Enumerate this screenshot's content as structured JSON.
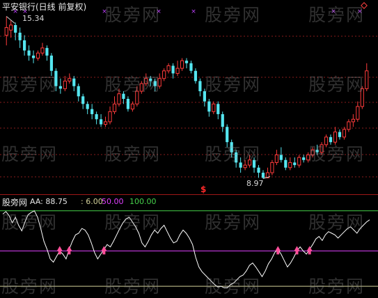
{
  "chart_data": [
    {
      "type": "candlestick",
      "title": "平安银行(日线 前复权)",
      "annotations": {
        "high_label": "15.34",
        "low_label": "8.97",
        "signal_glyph": "$"
      },
      "series": [
        {
          "name": "K线",
          "candles": [
            [
              14.6,
              14.9,
              15.34,
              14.2
            ],
            [
              14.8,
              15.0,
              15.2,
              14.5
            ],
            [
              15.0,
              14.7,
              15.1,
              14.4
            ],
            [
              14.7,
              14.4,
              14.9,
              14.1
            ],
            [
              14.4,
              14.0,
              14.6,
              13.8
            ],
            [
              14.0,
              13.8,
              14.2,
              13.6
            ],
            [
              13.8,
              13.7,
              14.0,
              13.5
            ],
            [
              13.7,
              13.9,
              14.0,
              13.6
            ],
            [
              13.9,
              14.1,
              14.3,
              13.8
            ],
            [
              14.1,
              13.8,
              14.2,
              13.6
            ],
            [
              13.8,
              13.2,
              13.9,
              13.0
            ],
            [
              13.2,
              12.6,
              13.3,
              12.4
            ],
            [
              12.6,
              12.5,
              12.9,
              12.3
            ],
            [
              12.5,
              12.8,
              13.0,
              12.4
            ],
            [
              12.8,
              12.9,
              13.1,
              12.7
            ],
            [
              12.9,
              12.6,
              13.0,
              12.4
            ],
            [
              12.6,
              12.2,
              12.7,
              12.0
            ],
            [
              12.2,
              11.9,
              12.3,
              11.7
            ],
            [
              11.9,
              11.7,
              12.0,
              11.5
            ],
            [
              11.7,
              11.5,
              11.9,
              11.3
            ],
            [
              11.5,
              11.3,
              11.6,
              11.1
            ],
            [
              11.3,
              11.1,
              11.5,
              11.0
            ],
            [
              11.1,
              11.2,
              11.4,
              11.0
            ],
            [
              11.2,
              11.6,
              11.8,
              11.1
            ],
            [
              11.6,
              11.9,
              12.2,
              11.5
            ],
            [
              11.9,
              12.3,
              12.5,
              11.8
            ],
            [
              12.3,
              12.1,
              12.4,
              11.9
            ],
            [
              12.1,
              11.7,
              12.2,
              11.6
            ],
            [
              11.7,
              11.9,
              12.0,
              11.6
            ],
            [
              11.9,
              12.4,
              12.6,
              11.8
            ],
            [
              12.4,
              12.7,
              12.8,
              12.3
            ],
            [
              12.7,
              12.9,
              13.1,
              12.6
            ],
            [
              12.9,
              12.8,
              13.0,
              12.6
            ],
            [
              12.8,
              12.6,
              12.9,
              12.4
            ],
            [
              12.6,
              12.9,
              13.1,
              12.5
            ],
            [
              12.9,
              13.2,
              13.3,
              12.8
            ],
            [
              13.2,
              13.4,
              13.5,
              13.1
            ],
            [
              13.4,
              13.1,
              13.5,
              12.9
            ],
            [
              13.1,
              13.3,
              13.6,
              13.0
            ],
            [
              13.3,
              13.6,
              13.7,
              13.2
            ],
            [
              13.6,
              13.5,
              13.7,
              13.3
            ],
            [
              13.5,
              13.2,
              13.6,
              13.1
            ],
            [
              13.2,
              12.8,
              13.3,
              12.7
            ],
            [
              12.8,
              12.4,
              12.9,
              12.2
            ],
            [
              12.4,
              12.0,
              12.5,
              11.8
            ],
            [
              12.0,
              11.6,
              12.1,
              11.4
            ],
            [
              11.6,
              11.9,
              12.0,
              11.5
            ],
            [
              11.9,
              11.5,
              12.0,
              11.3
            ],
            [
              11.5,
              11.0,
              11.6,
              10.8
            ],
            [
              11.0,
              10.4,
              11.1,
              10.2
            ],
            [
              10.4,
              10.0,
              10.5,
              9.8
            ],
            [
              10.0,
              9.6,
              10.1,
              9.4
            ],
            [
              9.6,
              9.4,
              9.8,
              9.2
            ],
            [
              9.4,
              9.5,
              9.7,
              9.3
            ],
            [
              9.5,
              9.7,
              9.9,
              9.4
            ],
            [
              9.7,
              9.4,
              9.8,
              9.2
            ],
            [
              9.4,
              9.2,
              9.5,
              9.0
            ],
            [
              9.2,
              9.0,
              9.3,
              8.97
            ],
            [
              9.0,
              9.2,
              9.4,
              8.98
            ],
            [
              9.2,
              9.6,
              9.7,
              9.1
            ],
            [
              9.6,
              9.9,
              10.1,
              9.5
            ],
            [
              9.9,
              9.7,
              10.2,
              9.6
            ],
            [
              9.7,
              9.4,
              9.8,
              9.3
            ],
            [
              9.4,
              9.6,
              9.8,
              9.3
            ],
            [
              9.6,
              9.5,
              9.8,
              9.4
            ],
            [
              9.5,
              9.8,
              9.9,
              9.4
            ],
            [
              9.8,
              9.7,
              9.9,
              9.6
            ],
            [
              9.7,
              9.9,
              10.0,
              9.6
            ],
            [
              9.9,
              10.1,
              10.2,
              9.8
            ],
            [
              10.1,
              10.0,
              10.3,
              9.9
            ],
            [
              10.0,
              10.3,
              10.4,
              9.9
            ],
            [
              10.3,
              10.6,
              10.7,
              10.2
            ],
            [
              10.6,
              10.4,
              10.7,
              10.3
            ],
            [
              10.4,
              10.8,
              11.0,
              10.3
            ],
            [
              10.8,
              10.6,
              10.9,
              10.5
            ],
            [
              10.6,
              10.9,
              11.0,
              10.5
            ],
            [
              10.9,
              11.2,
              11.3,
              10.8
            ],
            [
              11.2,
              11.3,
              11.5,
              11.0
            ],
            [
              11.3,
              11.8,
              12.0,
              11.2
            ],
            [
              11.8,
              12.5,
              12.6,
              11.7
            ],
            [
              12.5,
              13.2,
              13.5,
              12.4
            ]
          ]
        }
      ],
      "ylim": [
        8.6,
        15.6
      ]
    },
    {
      "type": "line",
      "title": "股旁网",
      "series": [
        {
          "name": "AA",
          "legend": "AA: 88.75",
          "color": "#ffffff",
          "values": [
            96,
            99,
            94,
            85,
            92,
            82,
            75,
            86,
            95,
            98,
            100,
            92,
            78,
            62,
            52,
            40,
            36,
            43,
            50,
            46,
            40,
            52,
            62,
            70,
            72,
            78,
            76,
            70,
            60,
            48,
            40,
            46,
            52,
            58,
            55,
            62,
            70,
            78,
            85,
            90,
            92,
            86,
            80,
            72,
            60,
            55,
            62,
            70,
            76,
            72,
            78,
            82,
            74,
            66,
            60,
            62,
            70,
            76,
            72,
            66,
            58,
            42,
            30,
            24,
            20,
            16,
            12,
            8,
            5,
            6,
            4,
            4,
            8,
            10,
            14,
            18,
            20,
            25,
            32,
            35,
            30,
            24,
            18,
            25,
            34,
            40,
            48,
            52,
            46,
            38,
            30,
            35,
            42,
            50,
            55,
            50,
            46,
            52,
            58,
            65,
            68,
            63,
            70,
            74,
            72,
            70,
            66,
            70,
            74,
            78,
            80,
            76,
            72,
            78,
            82,
            86,
            88.75
          ]
        },
        {
          "name": "L6",
          "legend": ": 6.00",
          "color": "#d4d29a",
          "values": [
            6
          ]
        },
        {
          "name": "L50",
          "legend": "50.00",
          "color": "#e040ff",
          "values": [
            50
          ]
        },
        {
          "name": "L100",
          "legend": "100.00",
          "color": "#46d24b",
          "values": [
            100
          ]
        }
      ],
      "ylim": [
        0,
        105
      ]
    }
  ],
  "watermark": "股旁网"
}
